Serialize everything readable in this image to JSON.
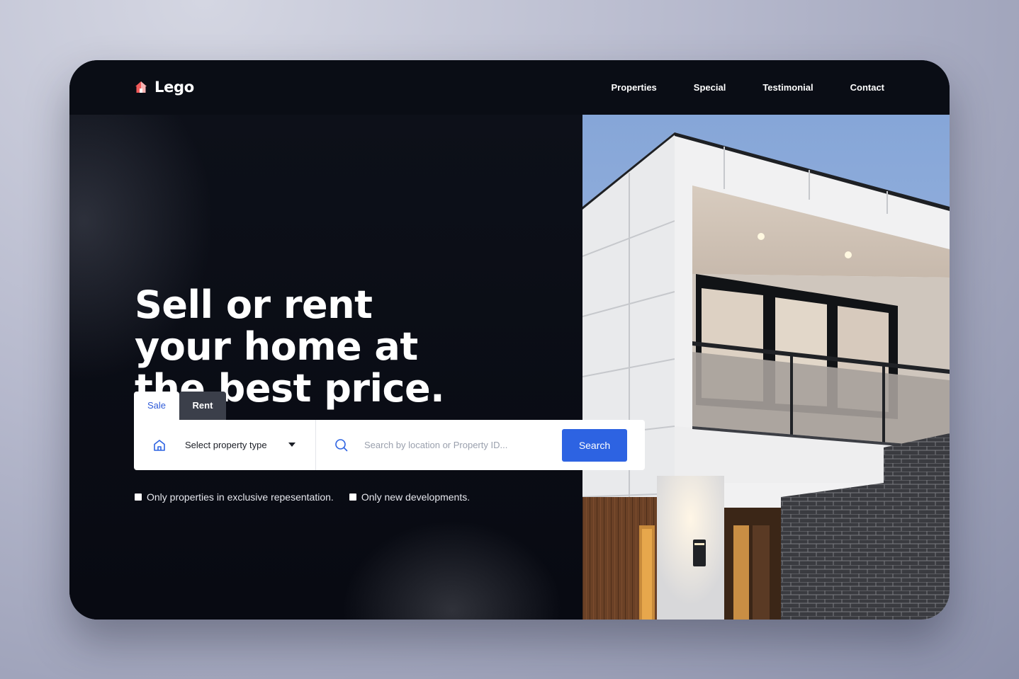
{
  "brand": {
    "name": "Lego",
    "icon": "house-icon",
    "icon_colors": [
      "#f15a5a",
      "#f8b4b4"
    ]
  },
  "nav": {
    "links": [
      "Properties",
      "Special",
      "Testimonial",
      "Contact"
    ]
  },
  "hero": {
    "headline_lines": [
      "Sell or rent",
      "your home at",
      "the best price."
    ],
    "image": "modern-house-photo"
  },
  "search": {
    "tabs": [
      {
        "label": "Sale",
        "active": true
      },
      {
        "label": "Rent",
        "active": false
      }
    ],
    "property_type": {
      "label": "Select property type",
      "icon": "home-icon"
    },
    "search_input": {
      "value": "",
      "placeholder": "Search by location or Property ID...",
      "icon": "search-icon"
    },
    "button_label": "Search"
  },
  "filters": [
    {
      "label": "Only properties in exclusive repesentation.",
      "checked": false
    },
    {
      "label": "Only new developments.",
      "checked": false
    }
  ],
  "colors": {
    "accent": "#2d63e2",
    "background_dark": "#0b0e16",
    "tab_inactive": "#3b3f4a"
  }
}
